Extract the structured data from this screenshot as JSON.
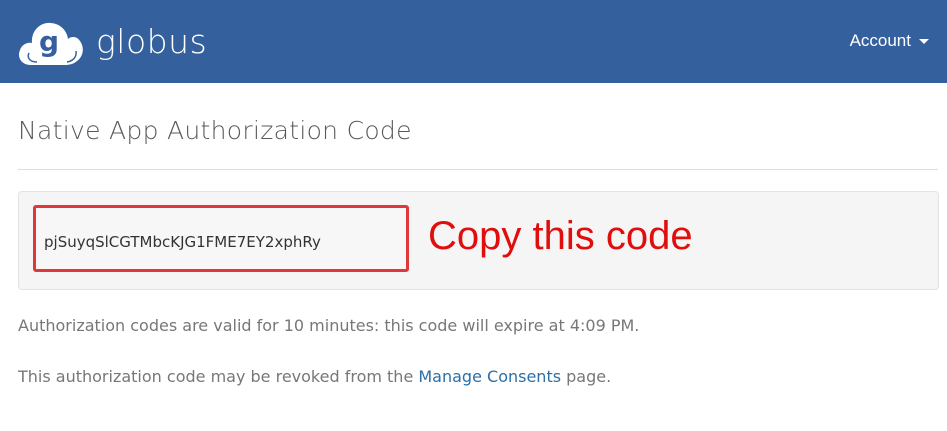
{
  "navbar": {
    "brand": "globus",
    "logo_icon": "globus-cloud-logo-icon",
    "account_label": "Account",
    "caret_icon": "caret-down-icon",
    "background_color": "#35609e"
  },
  "main": {
    "title": "Native App Authorization Code",
    "code": "pjSuyqSlCGTMbcKJG1FME7EY2xphRy",
    "annotation": "Copy this code",
    "annotation_color": "#e10e0e",
    "expiry_text": "Authorization codes are valid for 10 minutes: this code will expire at 4:09 PM.",
    "revoke_prefix": "This authorization code may be revoked from the",
    "revoke_link": "Manage Consents",
    "revoke_suffix": "page."
  }
}
